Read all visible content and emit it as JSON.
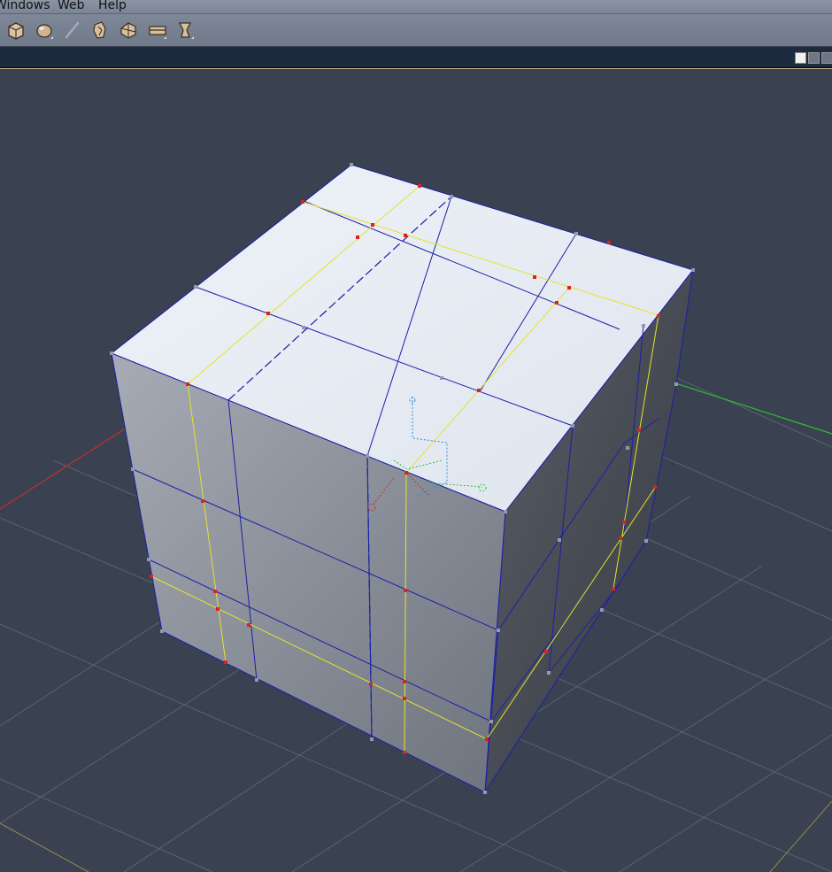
{
  "menu": {
    "items": [
      "Windows",
      "Web",
      "Help"
    ]
  },
  "toolbar": {
    "tools": [
      "box-tool-icon",
      "sphere-tool-icon",
      "pen-tool-icon",
      "figure-tool-icon",
      "move-tool-icon",
      "bridge-tool-icon",
      "morph-tool-icon"
    ]
  },
  "layout_controls": [
    "single-view-icon",
    "two-view-icon",
    "four-view-icon"
  ],
  "colors": {
    "viewport_bg": "#3a4150",
    "grid": "#5b6372",
    "axis_x": "#c22f2f",
    "axis_y": "#2fbf2f",
    "edge": "#1b1fa8",
    "selected_edge": "#e6e32a",
    "selected_vertex": "#e0201e",
    "vertex": "#8f9ab0"
  }
}
